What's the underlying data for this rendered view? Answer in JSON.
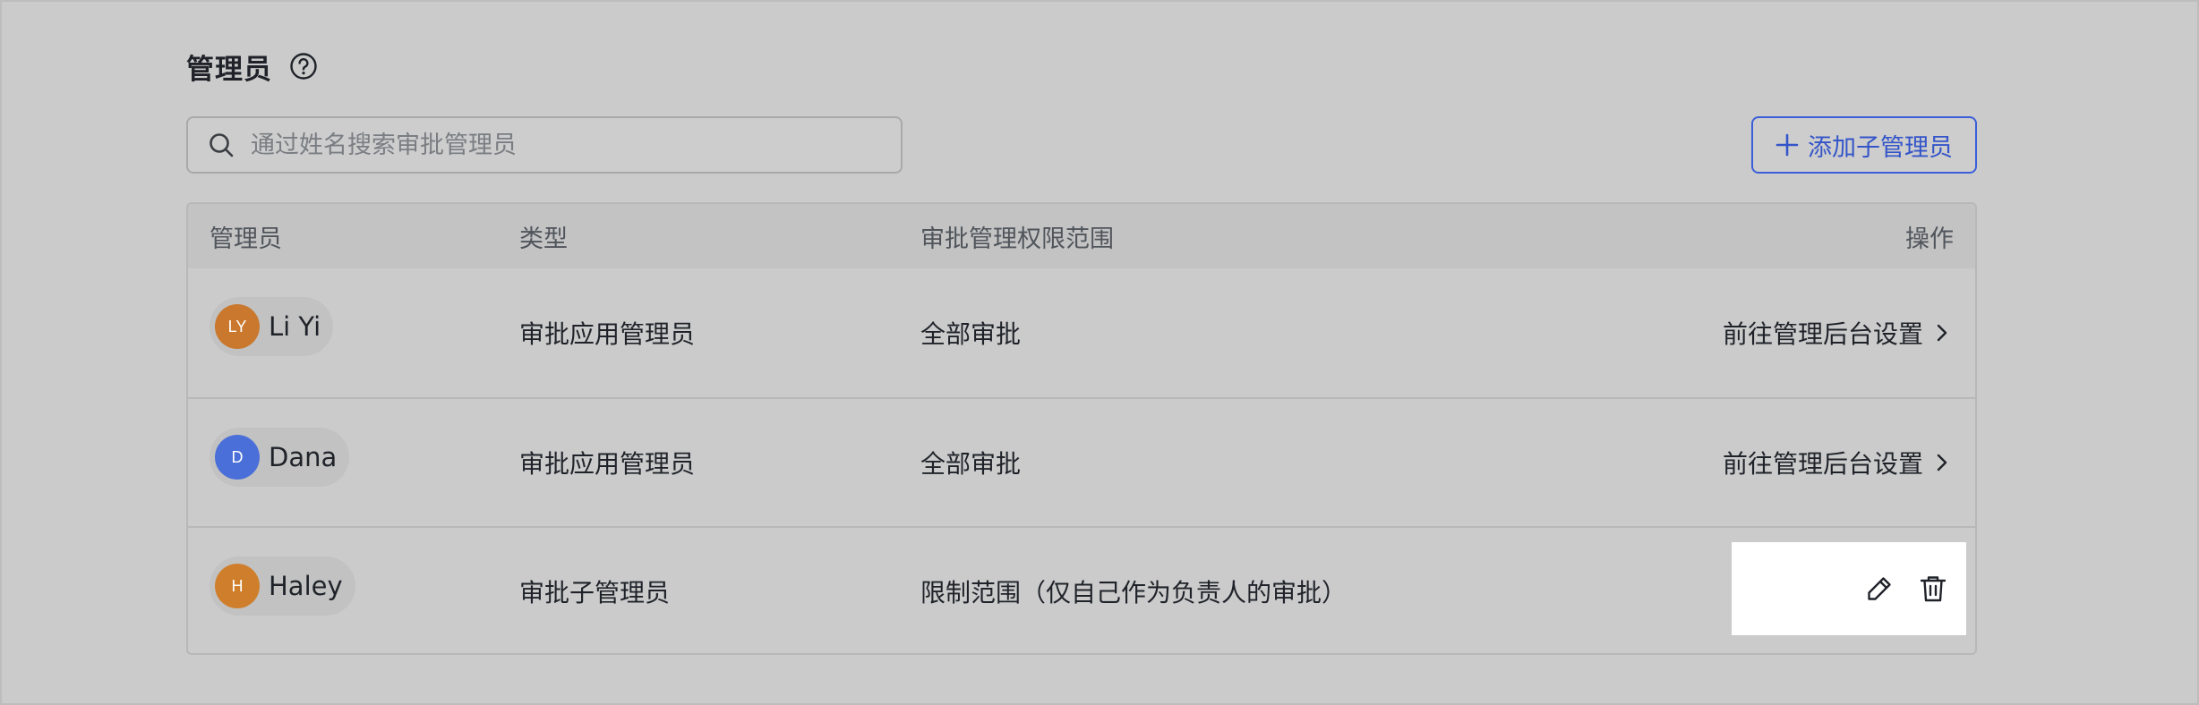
{
  "page": {
    "title": "管理员",
    "help_icon": "help-circle-icon"
  },
  "search": {
    "placeholder": "通过姓名搜索审批管理员",
    "value": "",
    "icon": "search-icon"
  },
  "add_button": {
    "label": "添加子管理员",
    "icon": "plus-icon",
    "color": "#3455c9"
  },
  "table": {
    "headers": {
      "admin": "管理员",
      "type": "类型",
      "scope": "审批管理权限范围",
      "operation": "操作"
    },
    "rows": [
      {
        "avatar_initials": "LY",
        "avatar_color": "#c9782e",
        "name": "Li Yi",
        "type": "审批应用管理员",
        "scope": "全部审批",
        "action_label": "前往管理后台设置"
      },
      {
        "avatar_initials": "D",
        "avatar_color": "#4a6fd8",
        "name": "Dana",
        "type": "审批应用管理员",
        "scope": "全部审批",
        "action_label": "前往管理后台设置"
      },
      {
        "avatar_initials": "H",
        "avatar_color": "#cf7f2c",
        "name": "Haley",
        "type": "审批子管理员",
        "scope": "限制范围（仅自己作为负责人的审批）",
        "actions": [
          "edit-icon",
          "delete-icon"
        ]
      }
    ]
  }
}
